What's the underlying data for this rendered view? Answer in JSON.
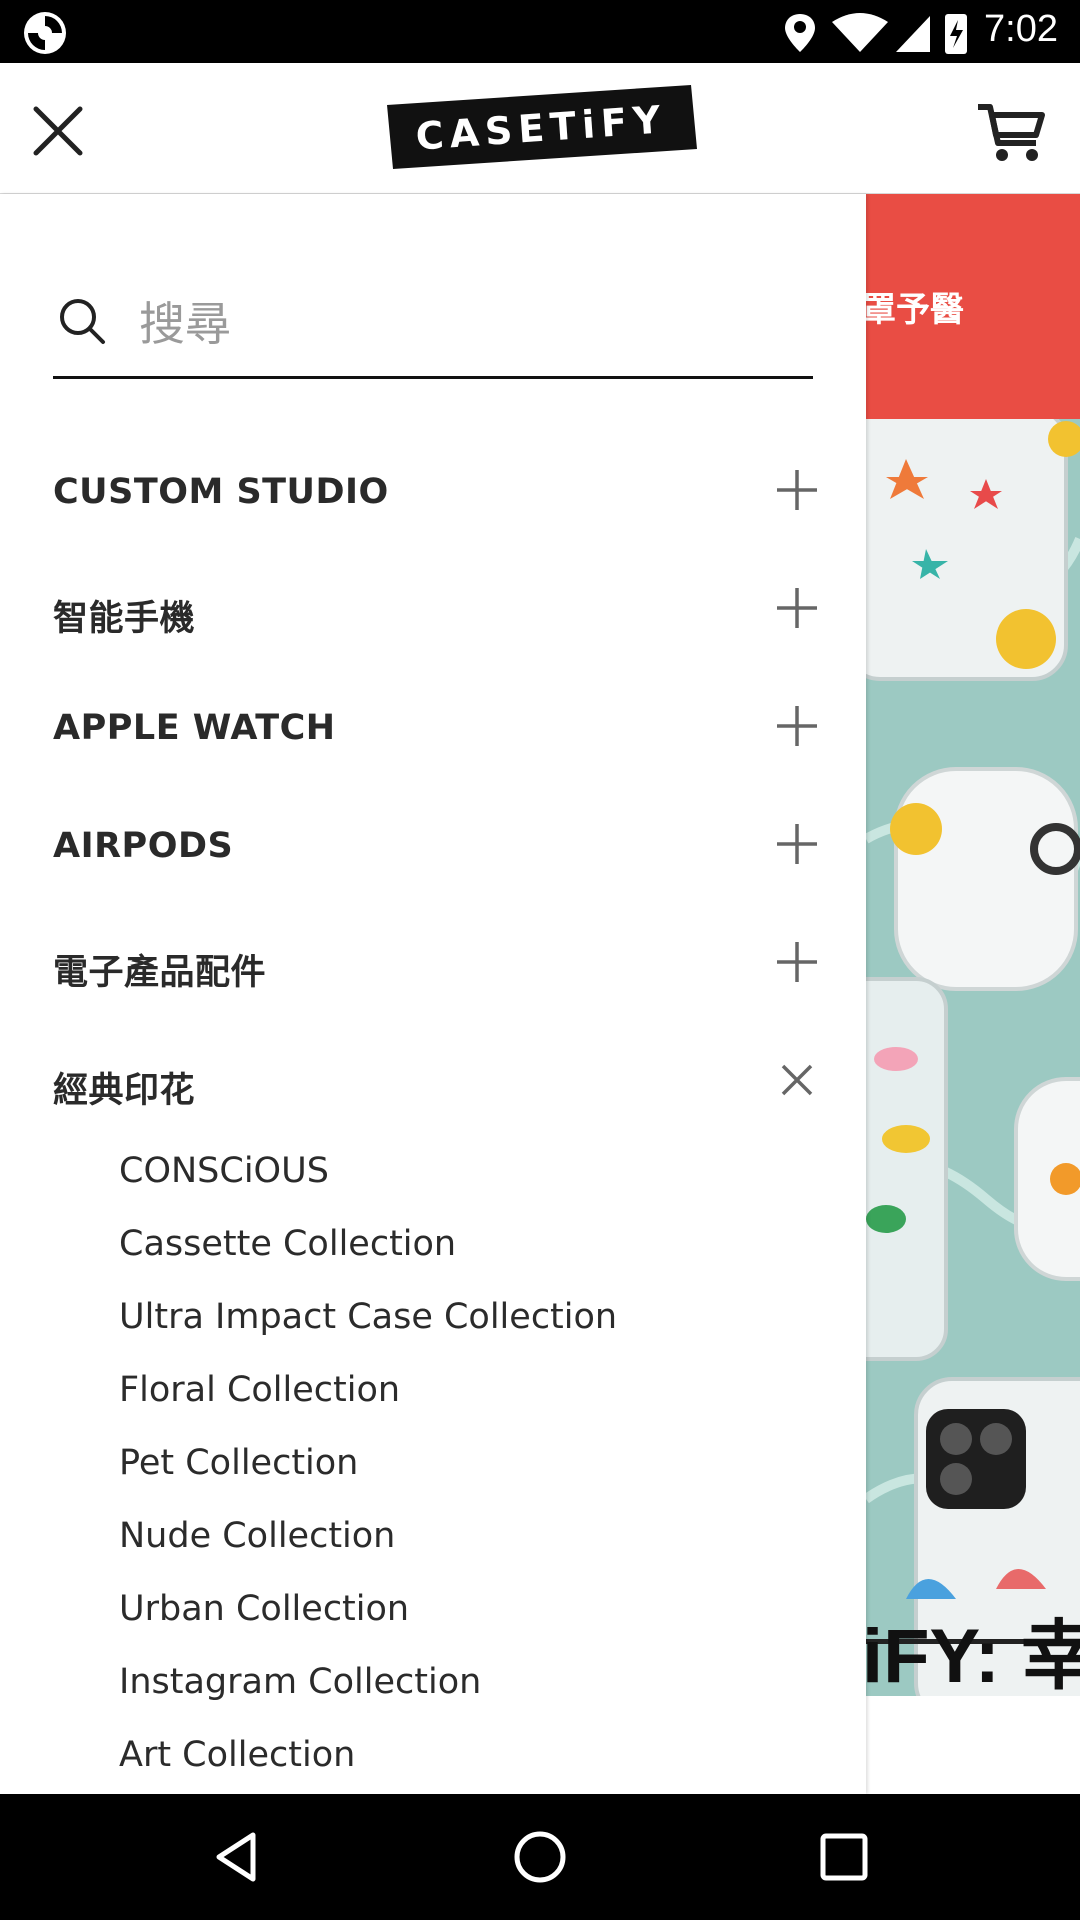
{
  "status_bar": {
    "time": "7:02"
  },
  "header": {
    "logo_text": "CASETiFY",
    "icons": {
      "close": "close-icon",
      "cart": "cart-icon"
    }
  },
  "background_page": {
    "promo_text": "罩予醫",
    "heading_partial": "iFY: 幸"
  },
  "drawer": {
    "search": {
      "placeholder": "搜尋",
      "value": ""
    },
    "menu": [
      {
        "label": "CUSTOM STUDIO",
        "expanded": false
      },
      {
        "label": "智能手機",
        "expanded": false
      },
      {
        "label": "APPLE WATCH",
        "expanded": false
      },
      {
        "label": "AIRPODS",
        "expanded": false
      },
      {
        "label": "電子產品配件",
        "expanded": false
      },
      {
        "label": "經典印花",
        "expanded": true
      }
    ],
    "submenu": [
      "CONSCiOUS",
      "Cassette Collection",
      "Ultra Impact Case Collection",
      "Floral Collection",
      "Pet Collection",
      "Nude Collection",
      "Urban Collection",
      "Instagram Collection",
      "Art Collection"
    ]
  },
  "colors": {
    "promo": "#e94d44",
    "text": "#2a2a2a",
    "accent": "#111111"
  },
  "nav_bar": {
    "icons": [
      "back-icon",
      "home-icon",
      "recents-icon"
    ]
  }
}
